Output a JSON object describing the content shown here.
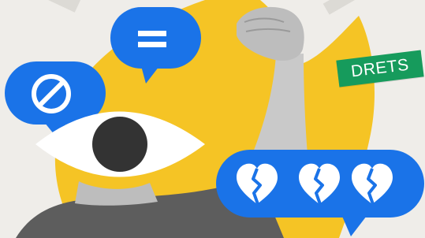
{
  "tag": {
    "label": "DRETS"
  },
  "icons": [
    "equals-icon",
    "prohibited-icon",
    "eye-icon",
    "broken-heart-icon"
  ],
  "colors": {
    "background": "#efede9",
    "flame": "#f5c425",
    "bubble": "#1a73e8",
    "tag": "#169b5c",
    "eye_white": "#ffffff",
    "pupil": "#333333"
  }
}
